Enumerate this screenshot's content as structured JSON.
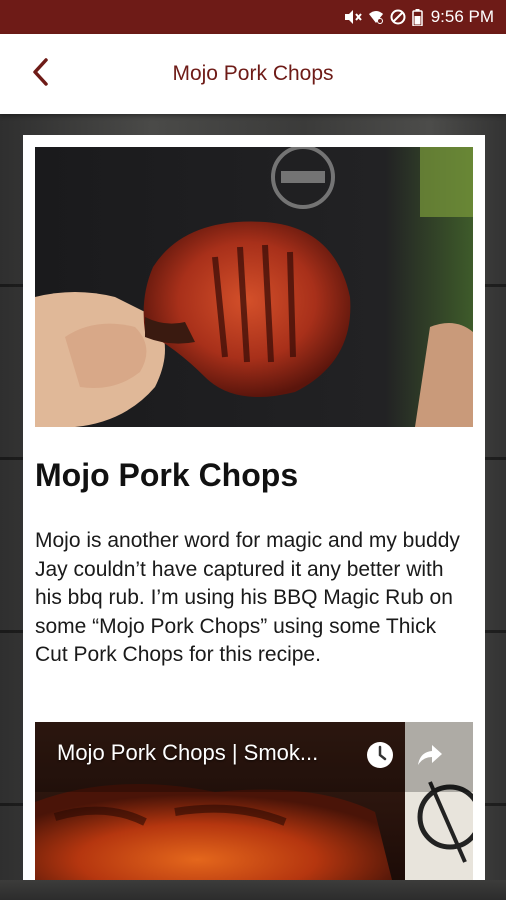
{
  "status_bar": {
    "time": "9:56 PM",
    "icons": [
      "mute-icon",
      "wifi-icon",
      "do-not-disturb-icon",
      "battery-icon"
    ]
  },
  "app_bar": {
    "title": "Mojo Pork Chops",
    "back_icon": "back-arrow-icon"
  },
  "recipe": {
    "title": "Mojo Pork Chops",
    "description": "Mojo is another word for magic and my buddy Jay couldn’t have captured it any better with his bbq rub. I’m using his BBQ Magic Rub on some “Mojo Pork Chops” using some Thick Cut Pork Chops for this recipe.",
    "hero_image": "grilled-pork-chop-photo"
  },
  "video": {
    "title": "Mojo Pork Chops | Smok...",
    "icons": [
      "watch-later-icon",
      "share-icon"
    ]
  },
  "colors": {
    "brand": "#6e1b17",
    "app_bar_bg": "#ffffff",
    "card_bg": "#ffffff",
    "text": "#111111"
  }
}
